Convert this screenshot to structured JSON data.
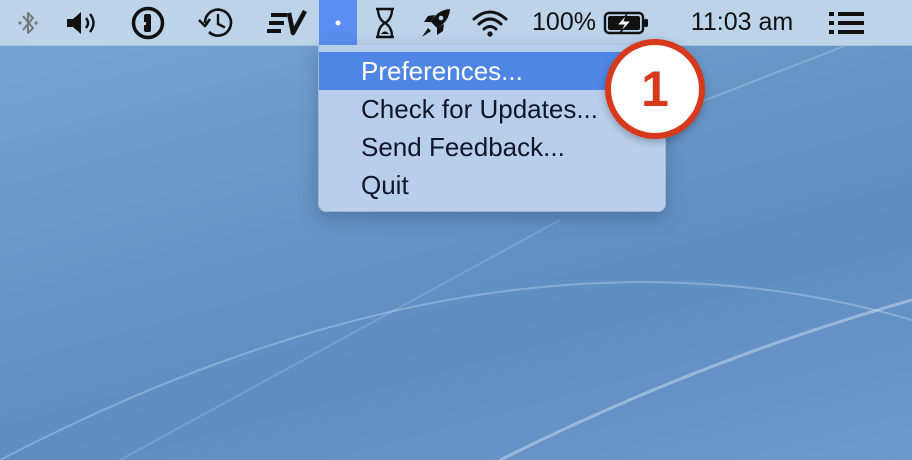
{
  "menubar": {
    "icons": [
      "bluetooth-icon",
      "volume-icon",
      "1password-icon",
      "time-machine-icon",
      "expressvpn-icon",
      "app-dot-icon",
      "hourglass-icon",
      "rocket-icon",
      "wifi-icon",
      "battery-charging-icon",
      "list-icon"
    ],
    "battery_percent": "100%",
    "clock": "11:03 am"
  },
  "dropdown": {
    "items": [
      {
        "label": "Preferences..."
      },
      {
        "label": "Check for Updates..."
      },
      {
        "label": "Send Feedback..."
      },
      {
        "label": "Quit"
      }
    ],
    "highlighted_index": 0
  },
  "annotation": {
    "badge_number": "1",
    "badge_color": "#d6391c"
  },
  "colors": {
    "menu_highlight": "#4f86e6",
    "active_menubar_item": "#5b8ef0",
    "desktop": "#6a97c8"
  }
}
